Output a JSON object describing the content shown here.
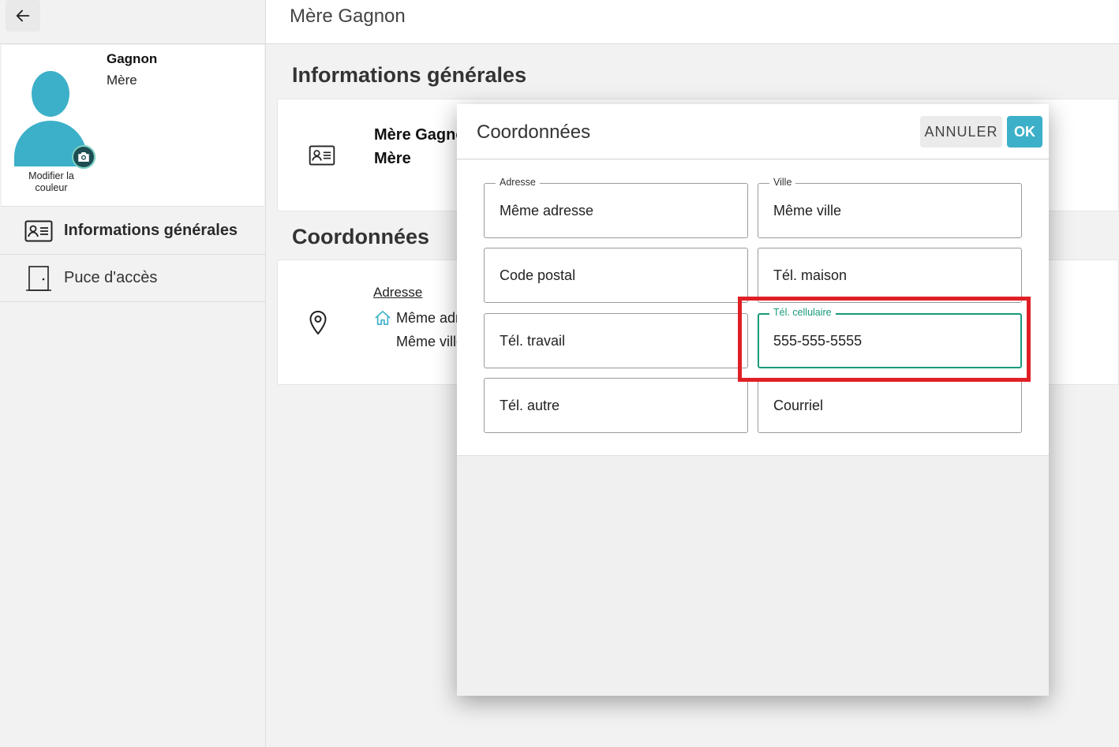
{
  "sidebar": {
    "profile": {
      "name": "Gagnon",
      "role": "Mère",
      "modify_color": "Modifier la couleur"
    },
    "items": [
      {
        "label": "Informations générales",
        "icon": "id-card-icon",
        "active": true
      },
      {
        "label": "Puce d'accès",
        "icon": "door-icon",
        "active": false
      }
    ]
  },
  "header": {
    "title": "Mère Gagnon"
  },
  "main": {
    "general_section": {
      "title": "Informations générales",
      "name": "Mère Gagnon",
      "role": "Mère"
    },
    "coordinates_section": {
      "title": "Coordonnées",
      "address_label": "Adresse",
      "address_line1": "Même adresse",
      "address_line2": "Même ville"
    }
  },
  "dialog": {
    "title": "Coordonnées",
    "cancel_label": "ANNULER",
    "ok_label": "OK",
    "fields": {
      "adresse": {
        "label": "Adresse",
        "value": "Même adresse"
      },
      "ville": {
        "label": "Ville",
        "value": "Même ville"
      },
      "code_postal": {
        "placeholder": "Code postal"
      },
      "tel_maison": {
        "placeholder": "Tél. maison"
      },
      "tel_travail": {
        "placeholder": "Tél. travail"
      },
      "tel_cellulaire": {
        "label": "Tél. cellulaire",
        "value": "555-555-5555"
      },
      "tel_autre": {
        "placeholder": "Tél. autre"
      },
      "courriel": {
        "placeholder": "Courriel"
      }
    }
  },
  "colors": {
    "accent": "#3cb0c8",
    "focus": "#179a7c",
    "highlight": "#e01f26"
  }
}
